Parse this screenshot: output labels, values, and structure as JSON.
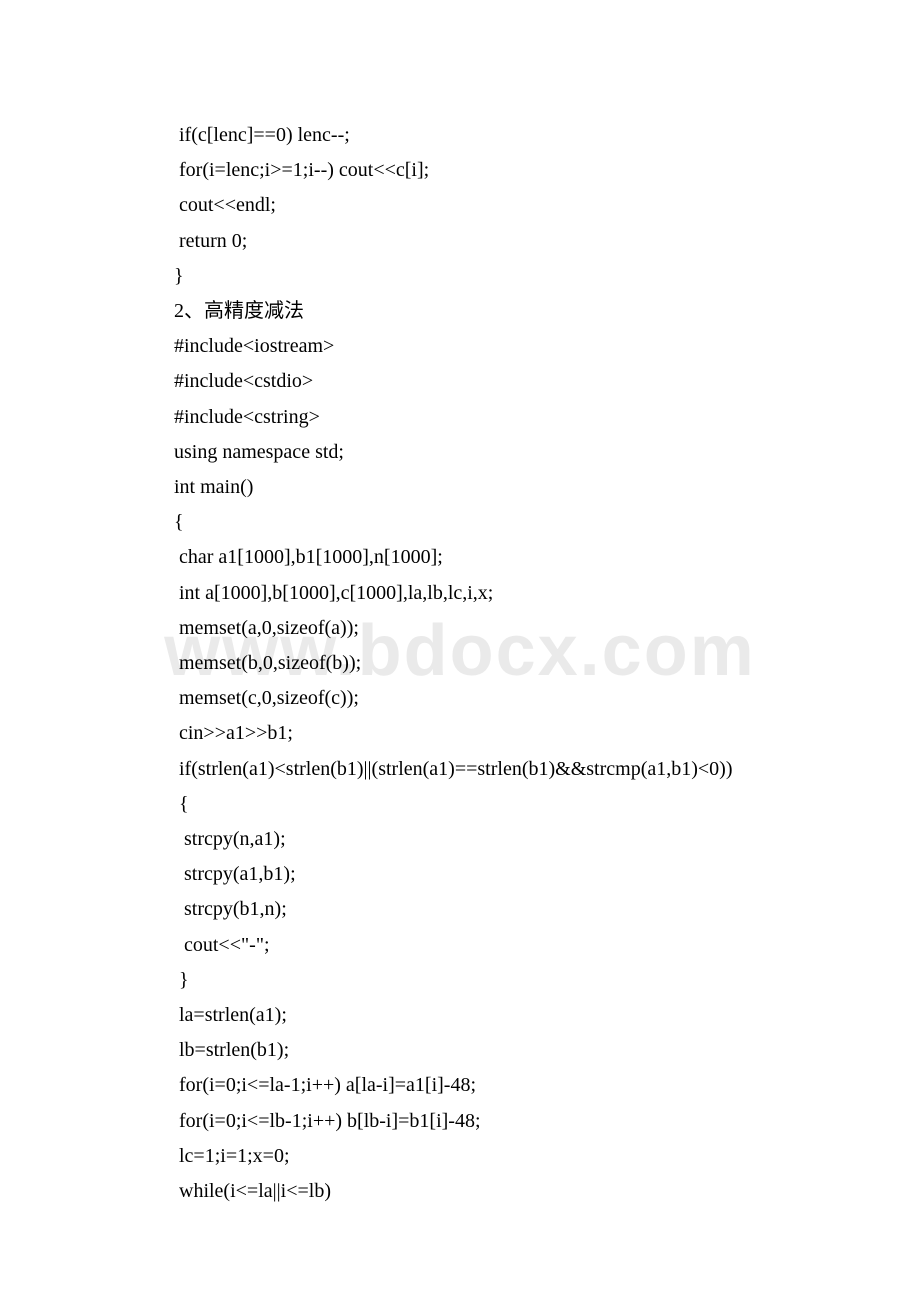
{
  "watermark": "www.bdocx.com",
  "lines": [
    " if(c[lenc]==0) lenc--;",
    " for(i=lenc;i>=1;i--) cout<<c[i];",
    " cout<<endl;",
    " return 0;",
    "}",
    "2、高精度减法",
    "#include<iostream>",
    "#include<cstdio>",
    "#include<cstring>",
    "using namespace std;",
    "int main()",
    "{",
    " char a1[1000],b1[1000],n[1000];",
    " int a[1000],b[1000],c[1000],la,lb,lc,i,x;",
    " memset(a,0,sizeof(a));",
    " memset(b,0,sizeof(b));",
    " memset(c,0,sizeof(c));",
    " cin>>a1>>b1;",
    " if(strlen(a1)<strlen(b1)||(strlen(a1)==strlen(b1)&&strcmp(a1,b1)<0))",
    " {",
    "  strcpy(n,a1);",
    "  strcpy(a1,b1);",
    "  strcpy(b1,n);",
    "  cout<<\"-\";",
    " }",
    " la=strlen(a1);",
    " lb=strlen(b1);",
    " for(i=0;i<=la-1;i++) a[la-i]=a1[i]-48;",
    " for(i=0;i<=lb-1;i++) b[lb-i]=b1[i]-48;",
    " lc=1;i=1;x=0;",
    " while(i<=la||i<=lb)"
  ]
}
